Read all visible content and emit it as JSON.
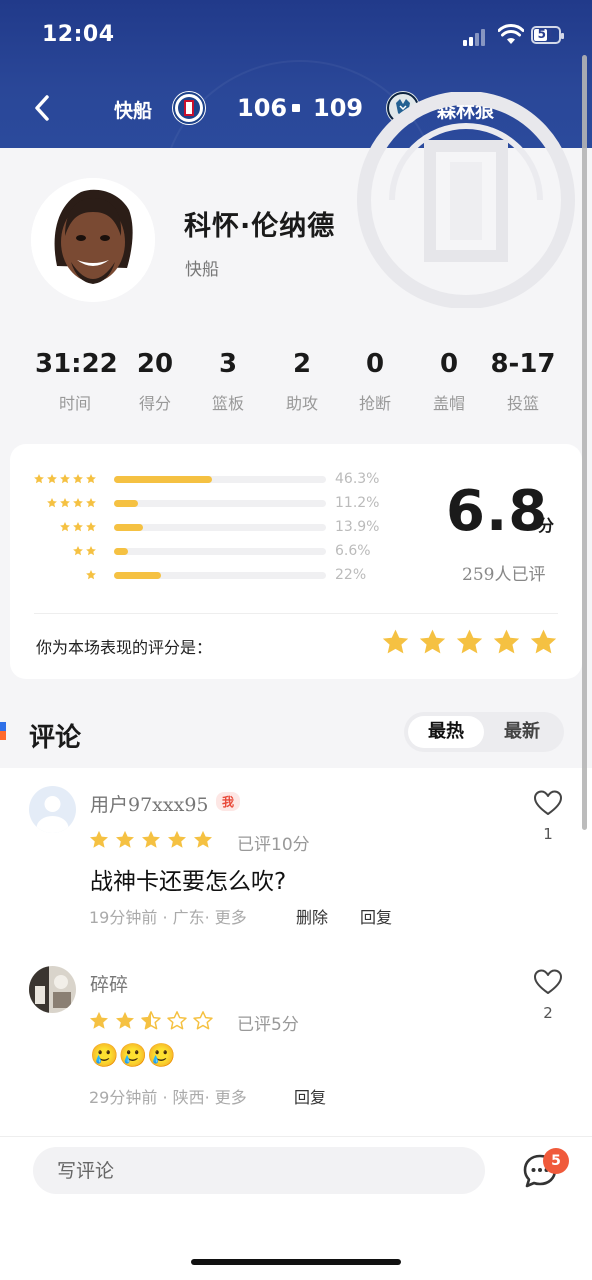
{
  "status_bar": {
    "time": "12:04",
    "battery": "51"
  },
  "game": {
    "home_team": "快船",
    "home_score": "106",
    "away_score": "109",
    "away_team": "森林狼"
  },
  "player": {
    "name": "科怀·伦纳德",
    "team": "快船"
  },
  "stats": [
    {
      "value": "31:22",
      "label": "时间"
    },
    {
      "value": "20",
      "label": "得分"
    },
    {
      "value": "3",
      "label": "篮板"
    },
    {
      "value": "2",
      "label": "助攻"
    },
    {
      "value": "0",
      "label": "抢断"
    },
    {
      "value": "0",
      "label": "盖帽"
    },
    {
      "value": "8-17",
      "label": "投篮"
    }
  ],
  "rating": {
    "distribution": [
      {
        "stars": 5,
        "pct": "46.3%",
        "fraction": 0.463
      },
      {
        "stars": 4,
        "pct": "11.2%",
        "fraction": 0.112
      },
      {
        "stars": 3,
        "pct": "13.9%",
        "fraction": 0.139
      },
      {
        "stars": 2,
        "pct": "6.6%",
        "fraction": 0.066
      },
      {
        "stars": 1,
        "pct": "22%",
        "fraction": 0.22
      }
    ],
    "score": "6.8",
    "unit": "分",
    "count": "259人已评",
    "my_rating_label": "你为本场表现的评分是：",
    "my_rating_stars": 5
  },
  "comments_section": {
    "title": "评论",
    "tab_hot": "最热",
    "tab_new": "最新"
  },
  "comments": [
    {
      "user": "用户97xxx95",
      "tag": "我",
      "stars": 5,
      "rated": "已评10分",
      "text": "战神卡还要怎么吹?",
      "meta": "19分钟前 · 广东· 更多",
      "delete": "删除",
      "reply": "回复",
      "likes": "1"
    },
    {
      "user": "碎碎",
      "stars": 2.5,
      "rated": "已评5分",
      "text": "🥲🥲🥲",
      "meta": "29分钟前 · 陕西· 更多",
      "reply": "回复",
      "likes": "2"
    }
  ],
  "bottom": {
    "placeholder": "写评论",
    "badge": "5"
  },
  "colors": {
    "header": "#2a4798",
    "star": "#f5c142",
    "badge": "#f05a3b"
  }
}
